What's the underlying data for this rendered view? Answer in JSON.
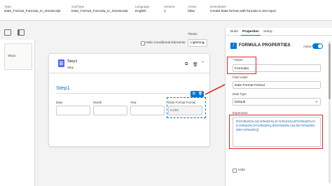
{
  "header": {
    "columns": [
      {
        "label": "Type",
        "value": "Date_Format_Formula_In_Omniscript"
      },
      {
        "label": "SubType",
        "value": "Date_Format_Formula_In_Omniscript"
      },
      {
        "label": "Language",
        "value": "English"
      },
      {
        "label": "Version",
        "value": "1"
      },
      {
        "label": "Active",
        "value": "false"
      },
      {
        "label": "Description",
        "value": "Create Date format with formula in text input"
      }
    ]
  },
  "left_panel": {
    "steps": [
      {
        "label": "Step1"
      }
    ]
  },
  "canvas": {
    "theme_label": "Theme",
    "hide_conditional_label": "Hide Conditional Elements",
    "theme_value": "Lightning",
    "step": {
      "title": "Step1",
      "subtitle": "Step",
      "big_label": "Step1",
      "fields": [
        {
          "label": "Date",
          "value": ""
        },
        {
          "label": "Month",
          "value": ""
        },
        {
          "label": "Year",
          "value": ""
        },
        {
          "label": "Date Format Formul",
          "value": "0,000"
        }
      ]
    }
  },
  "properties": {
    "tabs": [
      "Build",
      "Properties",
      "Setup"
    ],
    "active_tab": "Properties",
    "panel_title": "FORMULA PROPERTIES",
    "active_label": "Active",
    "active_on": true,
    "name_label": "* Name",
    "name_value": "Formula1",
    "field_label_label": "Field Label",
    "field_label_value": "Date Format Formul",
    "data_type_label": "Data Type",
    "data_type_value": "Default",
    "expression_label": "Expression",
    "expression_value": "IF(%Text1%<10,%Text1%),0+%Text1%),IF(%Text2%<10,%Text2%,0+%Text2%),IF(%Text3%<10,20+%Text3%,200+%Text3%))",
    "hide_label": "Hide"
  },
  "colors": {
    "accent": "#0176d3",
    "highlight": "#e0262b",
    "step_icon": "#5867e8"
  }
}
